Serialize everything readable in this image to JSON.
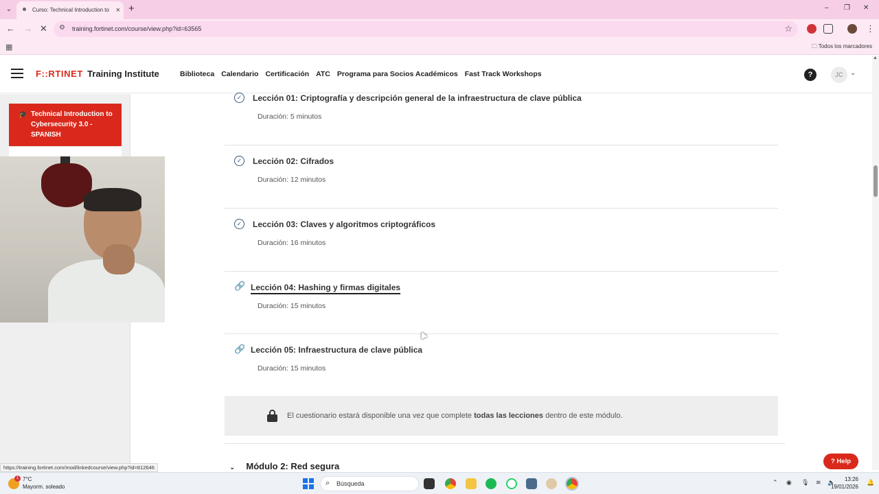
{
  "browser": {
    "tab_title": "Curso: Technical Introduction to",
    "new_tab": "+",
    "url": "training.fortinet.com/course/view.php?id=63565",
    "all_bookmarks": "Todos los marcadores",
    "window_controls": [
      "–",
      "❐",
      "✕"
    ]
  },
  "site": {
    "logo_mark": "F::RTINET",
    "logo_text": "Training Institute",
    "nav": [
      "Biblioteca",
      "Calendario",
      "Certificación",
      "ATC",
      "Programa para Socios Académicos",
      "Fast Track Workshops"
    ],
    "help_icon": "?",
    "user_initials": "JC"
  },
  "sidebar": {
    "course_title": "Technical Introduction to Cybersecurity 3.0 - SPANISH"
  },
  "lessons": [
    {
      "title": "Lección 01: Criptografía y descripción general de la infraestructura de clave pública",
      "duration": "Duración: 5 minutos",
      "status": "completed"
    },
    {
      "title": "Lección 02: Cifrados",
      "duration": "Duración: 12 minutos",
      "status": "completed"
    },
    {
      "title": "Lección 03: Claves y algoritmos criptográficos",
      "duration": "Duración: 16 minutos",
      "status": "completed"
    },
    {
      "title": "Lección 04: Hashing y firmas digitales",
      "duration": "Duración: 15 minutos",
      "status": "link"
    },
    {
      "title": "Lección 05: Infraestructura de clave pública",
      "duration": "Duración: 15 minutos",
      "status": "link"
    }
  ],
  "quiz_notice": {
    "before": "El cuestionario estará disponible una vez que complete",
    "bold": "todas las lecciones",
    "after": "dentro de este módulo."
  },
  "module_next": "Módulo 2: Red segura",
  "status_bar_url": "https://training.fortinet.com/mod/linkedcourse/view.php?id=812646",
  "help_button": "Help",
  "taskbar": {
    "weather_badge": "1",
    "temperature": "7°C",
    "weather_desc": "Mayorm. soleado",
    "search_label": "Búsqueda",
    "time": "13:26",
    "date": "19/01/2026"
  },
  "colors": {
    "brand_red": "#da291c",
    "check_blue": "#37587a",
    "chrome_pink": "#fde9f4"
  }
}
